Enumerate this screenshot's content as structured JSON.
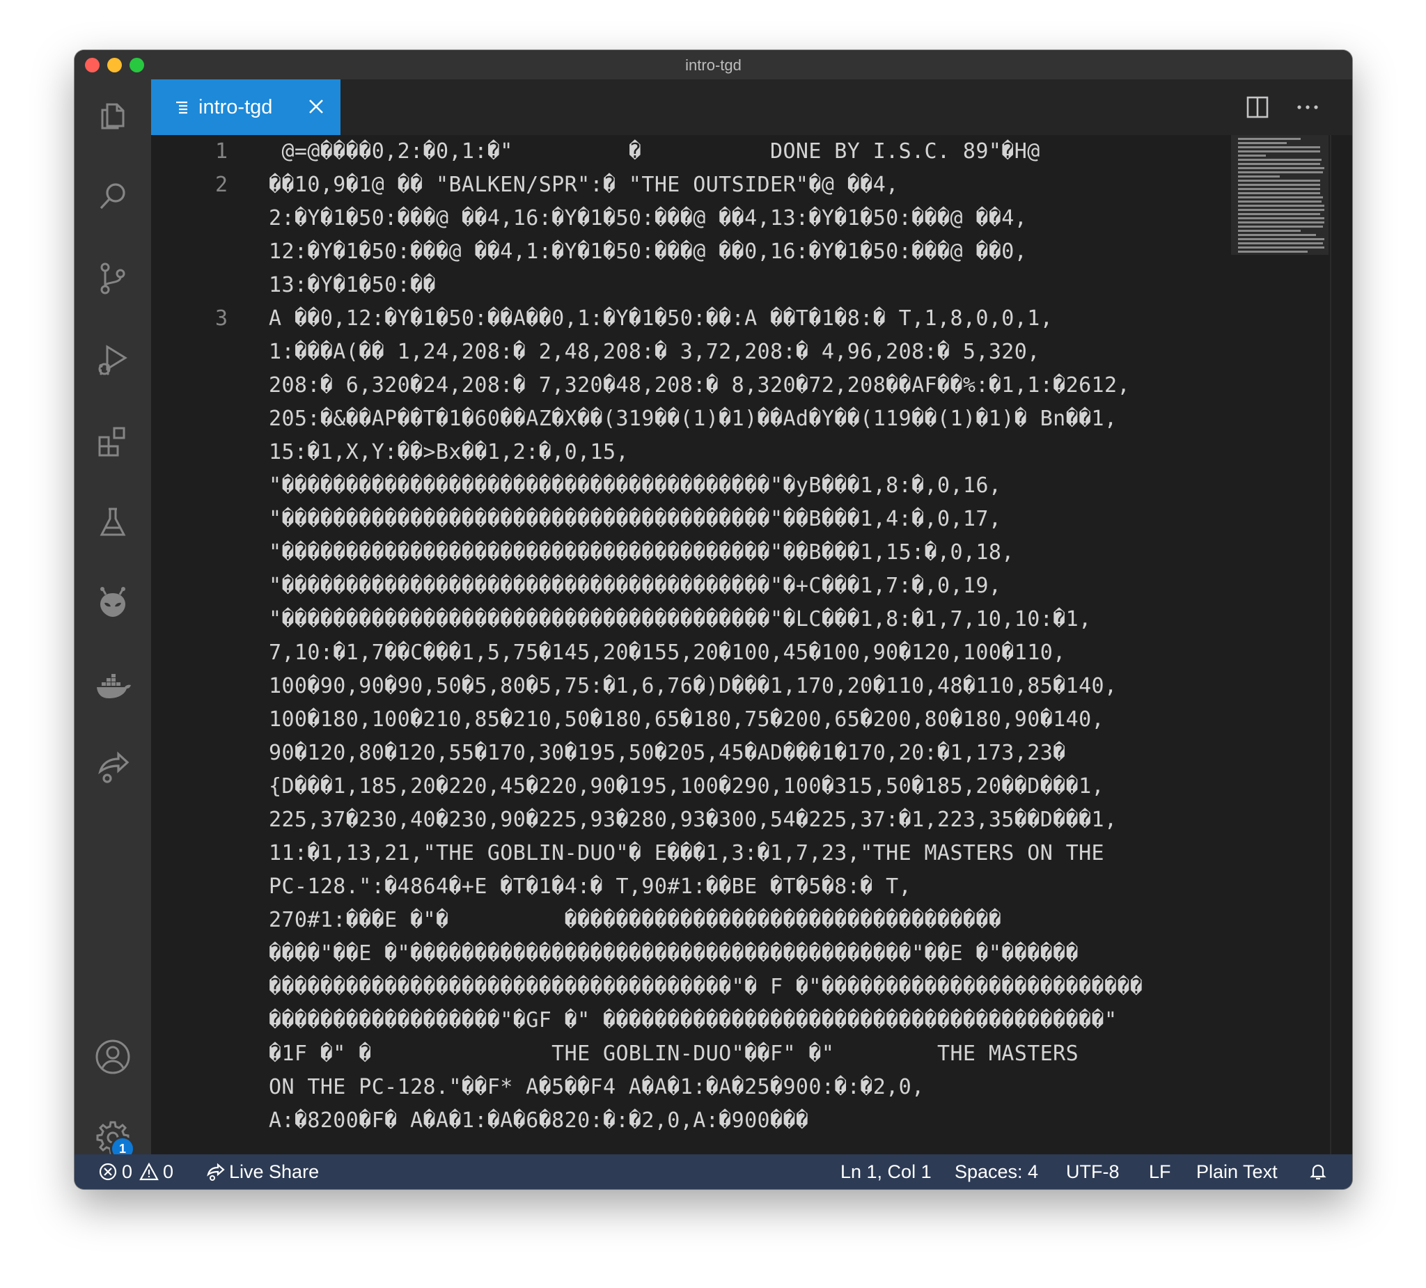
{
  "window": {
    "title": "intro-tgd"
  },
  "tab": {
    "label": "intro-tgd"
  },
  "editor": {
    "line_numbers": [
      "1",
      "2",
      "3"
    ],
    "lines": [
      " @=@����0,2:�0,1:�\"         �          DONE BY I.S.C. 89\"�H@",
      "��10,9�1@ �� \"BALKEN/SPR\":� \"THE OUTSIDER\"�@ ��4,",
      "2:�Y�1�50:���@ ��4,16:�Y�1�50:���@ ��4,13:�Y�1�50:���@ ��4,",
      "12:�Y�1�50:���@ ��4,1:�Y�1�50:���@ ��0,16:�Y�1�50:���@ ��0,",
      "13:�Y�1�50:��",
      "A ��0,12:�Y�1�50:��A��0,1:�Y�1�50:��:A ��T�1�8:� T,1,8,0,0,1,",
      "1:���A(�� 1,24,208:� 2,48,208:� 3,72,208:� 4,96,208:� 5,320,",
      "208:� 6,320�24,208:� 7,320�48,208:� 8,320�72,208��AF��%:�1,1:�2612,",
      "205:�&��AP��T�1�60��AZ�X��(319��(1)�1)��Ad�Y��(119��(1)�1)� Bn��1,",
      "15:�1,X,Y:��>Bx��1,2:�,0,15,",
      "\"��������������������������������������\"�yB���1,8:�,0,16,",
      "\"��������������������������������������\"��B���1,4:�,0,17,",
      "\"��������������������������������������\"��B���1,15:�,0,18,",
      "\"��������������������������������������\"�+C���1,7:�,0,19,",
      "\"��������������������������������������\"�LC���1,8:�1,7,10,10:�1,",
      "7,10:�1,7��C���1,5,75�145,20�155,20�100,45�100,90�120,100�110,",
      "100�90,90�90,50�5,80�5,75:�1,6,76�)D���1,170,20�110,48�110,85�140,",
      "100�180,100�210,85�210,50�180,65�180,75�200,65�200,80�180,90�140,",
      "90�120,80�120,55�170,30�195,50�205,45�AD���1�170,20:�1,173,23�",
      "{D���1,185,20�220,45�220,90�195,100�290,100�315,50�185,20��D���1,",
      "225,37�230,40�230,90�225,93�280,93�300,54�225,37:�1,223,35��D���1,",
      "11:�1,13,21,\"THE GOBLIN-DUO\"� E���1,3:�1,7,23,\"THE MASTERS ON THE",
      "PC-128.\":�4864�+E �T�1�4:� T,90#1:��BE �T�5�8:� T,",
      "270#1:���E �\"�         ����������������������������������",
      "����\"��E �\"���������������������������������������\"��E �\"������",
      "������������������������������������\"� F �\"�������������������������",
      "������������������\"�GF �\" ���������������������������������������\"",
      "�1F �\" �              THE GOBLIN-DUO\"��F\" �\"        THE MASTERS",
      "ON THE PC-128.\"��F* A�5��F4 A�A�1:�A�25�900:�:�2,0,",
      "A:�8200�F� A�A�1:�A�6�820:�:�2,0,A:�900���"
    ]
  },
  "statusbar": {
    "errors": "0",
    "warnings": "0",
    "live_share": "Live Share",
    "position": "Ln 1, Col 1",
    "spaces": "Spaces: 4",
    "encoding": "UTF-8",
    "eol": "LF",
    "language": "Plain Text"
  },
  "activity_bar": {
    "settings_badge": "1",
    "icons": [
      "files-icon",
      "search-icon",
      "source-control-icon",
      "run-debug-icon",
      "extensions-icon",
      "testing-icon",
      "alien-icon",
      "docker-icon",
      "live-share-icon",
      "account-icon",
      "gear-icon"
    ]
  },
  "colors": {
    "accent": "#1d89d8",
    "statusbar": "#2d3b55",
    "editor_bg": "#1e1e1e",
    "activity_bar": "#333333",
    "badge": "#0e78d5"
  }
}
